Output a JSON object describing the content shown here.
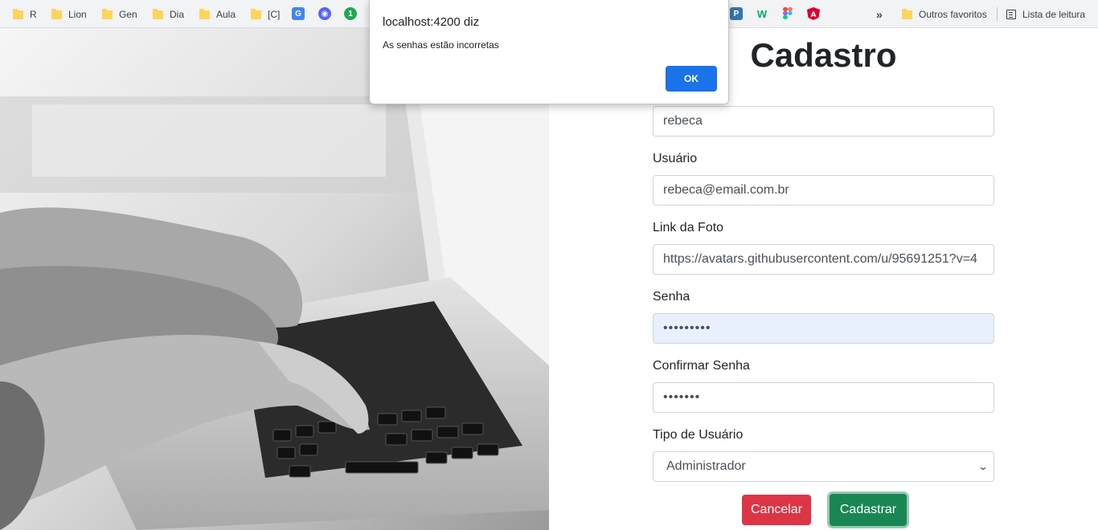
{
  "bookmarks": {
    "folders": [
      "R",
      "Lion",
      "Gen",
      "Dia",
      "Aula",
      "[C]"
    ],
    "extension_icons": [
      "google-translate-icon",
      "discord-icon",
      "green-badge-icon",
      "python-icon",
      "w3schools-icon",
      "figma-icon",
      "angular-icon"
    ],
    "more_label": "»",
    "other_favorites": "Outros favoritos",
    "reading_list": "Lista de leitura"
  },
  "dialog": {
    "title": "localhost:4200 diz",
    "message": "As senhas estão incorretas",
    "ok_label": "OK"
  },
  "form": {
    "title": "Cadastro",
    "fields": {
      "name_value": "rebeca",
      "user_label": "Usuário",
      "user_value": "rebeca@email.com.br",
      "photo_label": "Link da Foto",
      "photo_value": "https://avatars.githubusercontent.com/u/95691251?v=4",
      "password_label": "Senha",
      "password_value": "•••••••••",
      "confirm_label": "Confirmar Senha",
      "confirm_value": "•••••••",
      "type_label": "Tipo de Usuário",
      "type_value": "Administrador"
    },
    "cancel_label": "Cancelar",
    "submit_label": "Cadastrar"
  },
  "colors": {
    "danger": "#dc3545",
    "success": "#198754",
    "dialog_button": "#1a73e8",
    "autofill": "#e8f0fe"
  }
}
